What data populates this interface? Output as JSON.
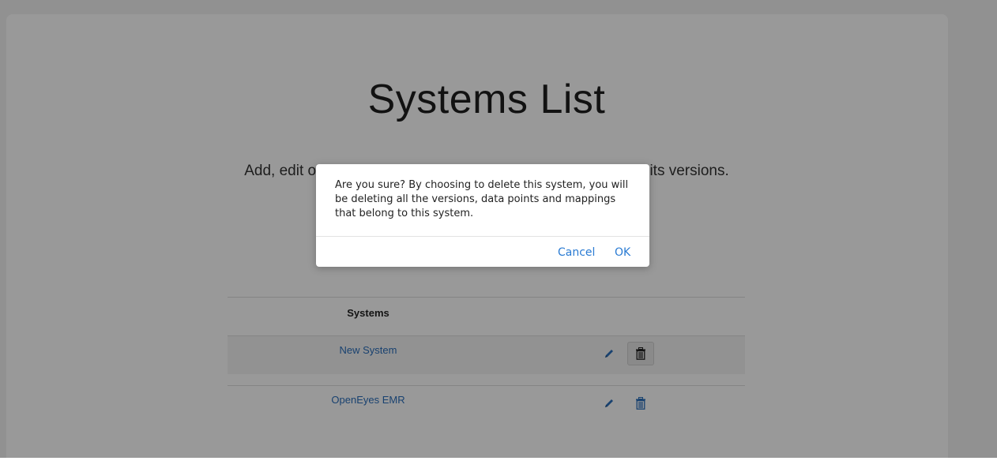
{
  "page": {
    "title": "Systems List",
    "subtitle": "Add, edit or delete systems. Click on a system below to view its versions."
  },
  "table": {
    "header": "Systems",
    "rows": [
      {
        "name": "New System"
      },
      {
        "name": "OpenEyes EMR"
      }
    ]
  },
  "icons": {
    "edit": "pencil-icon",
    "delete": "trash-icon"
  },
  "dialog": {
    "message": "Are you sure? By choosing to delete this system, you will be deleting all the versions, data points and mappings that belong to this system.",
    "cancel_label": "Cancel",
    "ok_label": "OK"
  },
  "colors": {
    "link": "#2a6ebb",
    "dialog_button": "#2a7bd3",
    "overlay": "rgba(0,0,0,0.4)"
  }
}
